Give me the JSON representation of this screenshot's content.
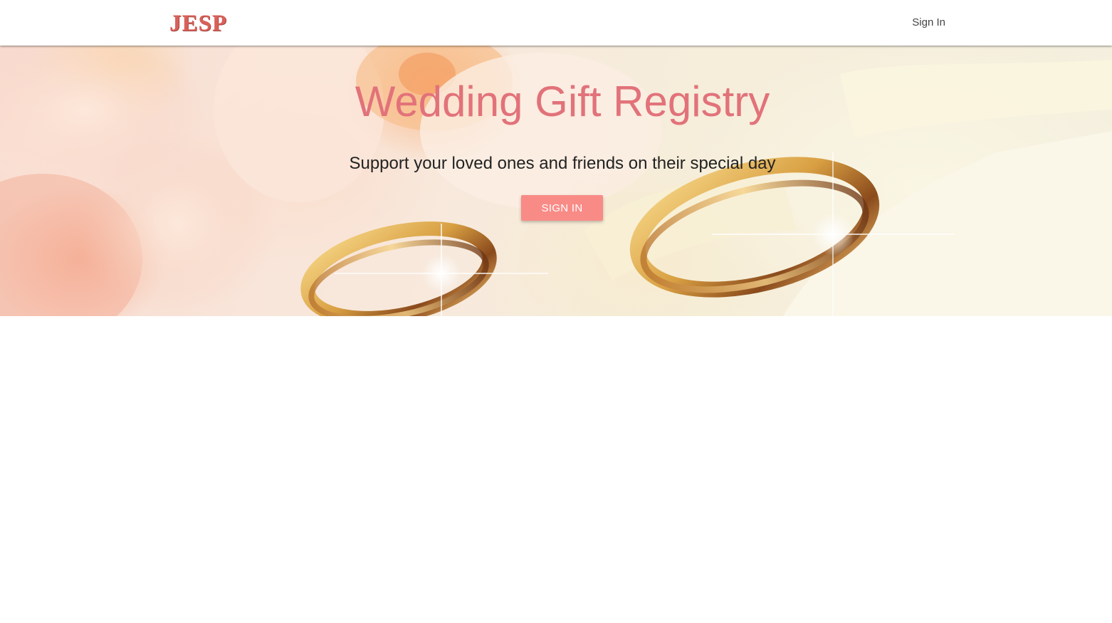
{
  "navbar": {
    "logo_text": "JESP",
    "signin_label": "Sign In"
  },
  "hero": {
    "title": "Wedding Gift Registry",
    "subtitle": "Support your loved ones and friends on their special day",
    "button_label": "SIGN IN"
  },
  "colors": {
    "brand": "#d8615a",
    "title": "#e2727a",
    "button": "#f98b87"
  }
}
